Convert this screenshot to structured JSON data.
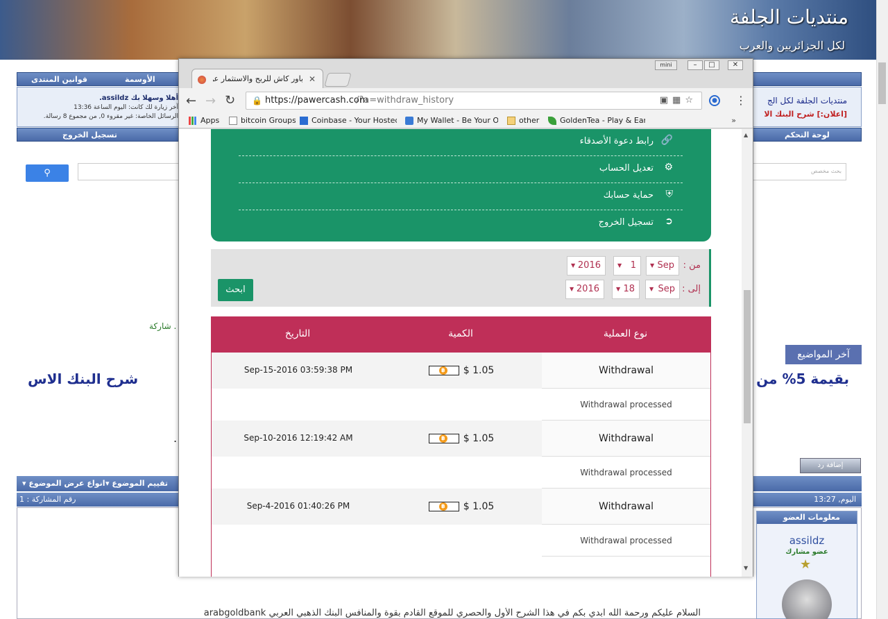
{
  "forum": {
    "banner_title": "منتديات الجلفة",
    "banner_subtitle": "لكل الجزائريين والعرب",
    "nav_top": [
      "قوانين المنتدى",
      "الأوسمة"
    ],
    "welcome": "أهلا وسهلا بك assildz.",
    "last_visit": "آخر زيارة لك كانت: اليوم الساعة 13:36",
    "private_msgs": "الرسائل الخاصة: غير مقروء 0, من مجموع 8 رسالة.",
    "forum_link": "منتديات الجلفة لكل الج",
    "announcement": "[اعلان:] شرح البنك الا",
    "nav_bottom_left": "تسجيل الخروج",
    "nav_bottom_right": "لوحة التحكم",
    "search_placeholder": "بحث مخصص",
    "green_note": "شاركة .",
    "latest_label": "آخر المواضيع",
    "headline_right": "شرح البنك الاس",
    "headline_right2": "بقيمة 5% من اجمالي",
    "reply_button": "إضافة رد",
    "tools": [
      "انواع عرض الموضوع",
      "تقييم الموضوع"
    ],
    "post_date": "اليوم, 13:27",
    "post_number": "رقم المشاركة : 1",
    "member_info_title": "معلومات العضو",
    "member_name": "assildz",
    "member_rank": "عضو مشارك",
    "post_text": "السلام عليكم ورحمة الله ابدي بكم في هذا الشرح الأول والحصري للموقع القادم بقوة والمنافس البنك الذهبي العربي arabgoldbank"
  },
  "browser": {
    "win_mini": "mini",
    "tab_title": "باور كاش للربح والاستثمار عن",
    "url_domain": "https://pawercash.com",
    "url_path": "/?a=withdraw_history",
    "bookmarks": [
      {
        "label": "Apps",
        "icon": "apps-grid-icon"
      },
      {
        "label": "bitcoin Groups",
        "icon": "page-icon"
      },
      {
        "label": "Coinbase - Your Hosted",
        "icon": "coinbase-icon"
      },
      {
        "label": "My Wallet - Be Your Ow",
        "icon": "blockchain-icon"
      },
      {
        "label": "other",
        "icon": "folder-icon"
      },
      {
        "label": "GoldenTea - Play & Ear",
        "icon": "leaf-icon"
      }
    ]
  },
  "site": {
    "menu": [
      {
        "label": "رابط دعوة الأصدقاء",
        "icon": "link-icon"
      },
      {
        "label": "تعديل الحساب",
        "icon": "gear-icon"
      },
      {
        "label": "حماية حسابك",
        "icon": "shield-icon"
      },
      {
        "label": "تسجيل الخروج",
        "icon": "logout-icon"
      }
    ],
    "filter": {
      "from_label": "من :",
      "to_label": "إلى :",
      "from": {
        "month": "Sep",
        "day": "1",
        "year": "2016"
      },
      "to": {
        "month": "Sep",
        "day": "18",
        "year": "2016"
      },
      "search_button": "ابحث"
    },
    "table": {
      "headers": [
        "نوع العملية",
        "الكمية",
        "التاريخ"
      ],
      "rows": [
        {
          "type": "Withdrawal",
          "amount": "$ 1.05",
          "date": "Sep-15-2016 03:59:38 PM",
          "status": "Withdrawal processed"
        },
        {
          "type": "Withdrawal",
          "amount": "$ 1.05",
          "date": "Sep-10-2016 12:19:42 AM",
          "status": "Withdrawal processed"
        },
        {
          "type": "Withdrawal",
          "amount": "$ 1.05",
          "date": "Sep-4-2016 01:40:26 PM",
          "status": "Withdrawal processed"
        }
      ]
    }
  },
  "colors": {
    "site_green": "#1a9468",
    "site_red": "#bf2f58",
    "forum_blue": "#4a6aa8"
  }
}
